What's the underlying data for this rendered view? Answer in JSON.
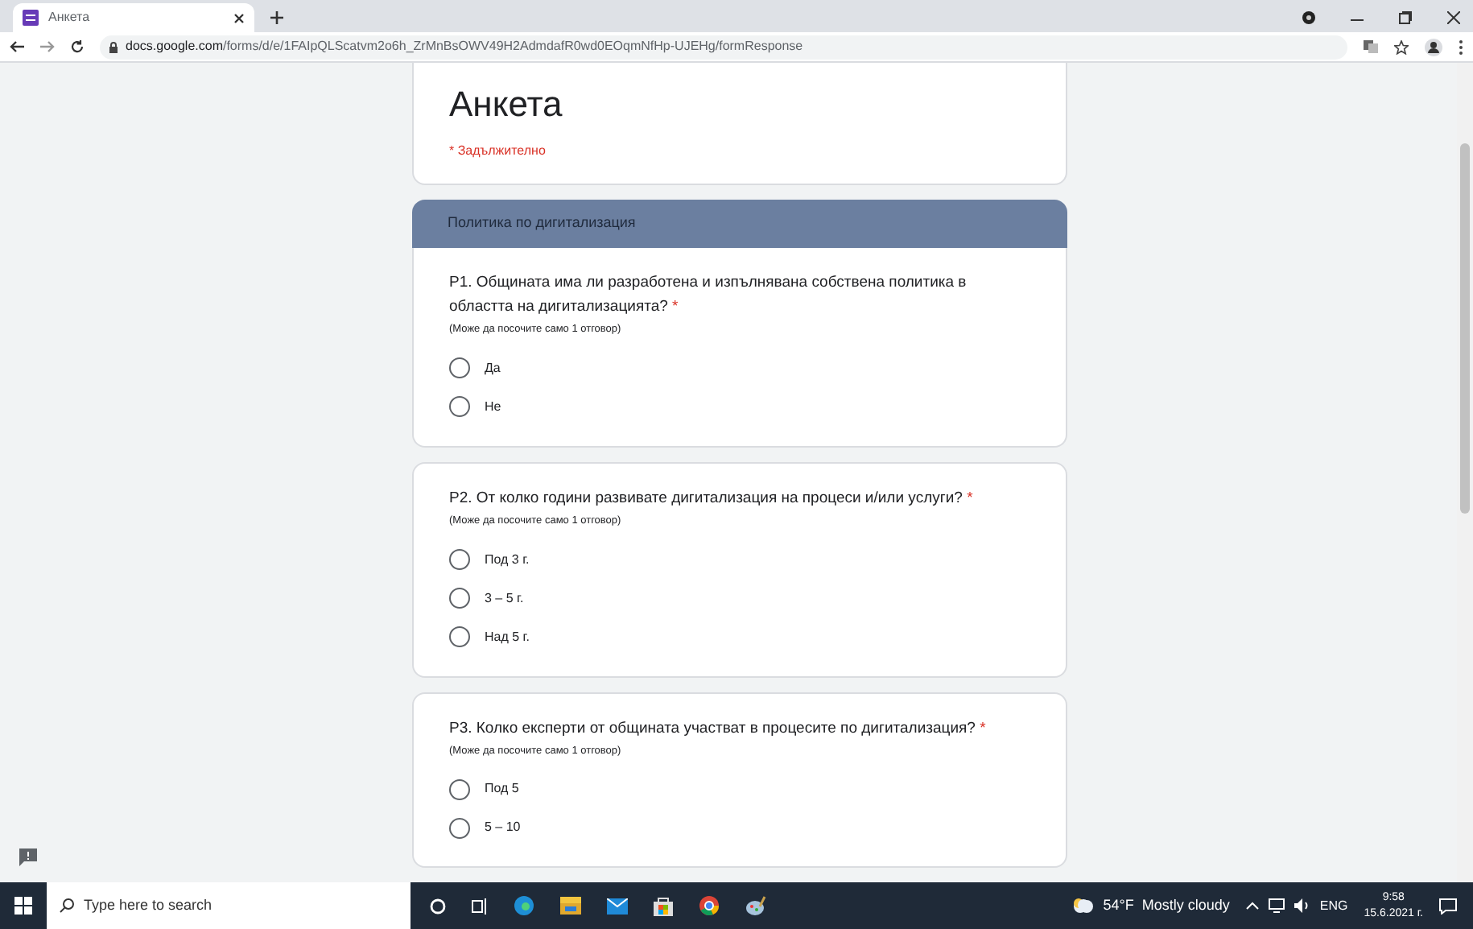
{
  "browser": {
    "tab_title": "Анкета",
    "url_host": "docs.google.com",
    "url_path": "/forms/d/e/1FAIpQLScatvm2o6h_ZrMnBsOWV49H2AdmdafR0wd0EOqmNfHp-UJEHg/formResponse"
  },
  "form": {
    "title": "Анкета",
    "required_note": "* Задължително",
    "section": {
      "title": "Политика по дигитализация"
    },
    "questions": [
      {
        "text": "P1. Общината има ли разработена и изпълнявана собствена политика в областта на дигитализацията?",
        "required_mark": "*",
        "hint": "(Може да посочите само 1 отговор)",
        "options": [
          {
            "label": "Да",
            "selected": false
          },
          {
            "label": "Не",
            "selected": false
          }
        ]
      },
      {
        "text": "P2. От колко години развивате дигитализация на процеси и/или услуги?",
        "required_mark": "*",
        "hint": "(Може да посочите само 1 отговор)",
        "options": [
          {
            "label": "Под 3 г.",
            "selected": false
          },
          {
            "label": "3 – 5 г.",
            "selected": false
          },
          {
            "label": "Над 5 г.",
            "selected": false
          }
        ]
      },
      {
        "text": "P3. Колко експерти от общината участват в процесите по дигитализация?",
        "required_mark": "*",
        "hint": "(Може да посочите само 1 отговор)",
        "options": [
          {
            "label": "Под 5",
            "selected": false
          },
          {
            "label": "5 – 10",
            "selected": false
          }
        ]
      }
    ]
  },
  "taskbar": {
    "search_placeholder": "Type here to search",
    "weather": "54°F  Mostly cloudy",
    "language": "ENG",
    "time": "9:58",
    "date": "15.6.2021 г."
  }
}
